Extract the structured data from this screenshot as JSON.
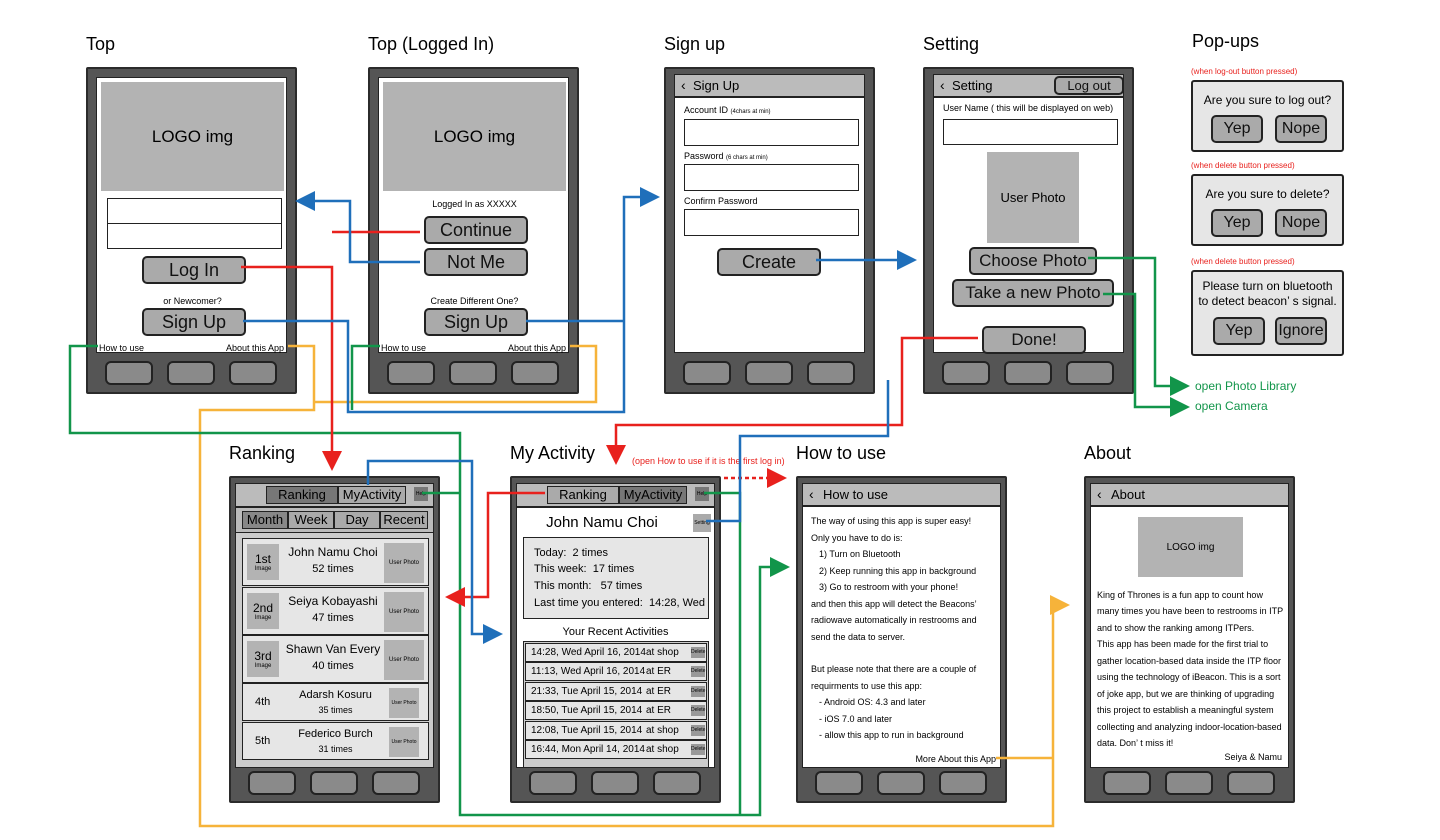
{
  "titles": {
    "top": "Top",
    "top_logged": "Top (Logged In)",
    "signup": "Sign up",
    "setting": "Setting",
    "popups": "Pop-ups",
    "ranking": "Ranking",
    "activity": "My Activity",
    "howto": "How to use",
    "about": "About"
  },
  "top": {
    "logo": "LOGO img",
    "login": "Log In",
    "newcomer": "or Newcomer?",
    "signup": "Sign Up",
    "howto": "How to use",
    "about": "About this App"
  },
  "top_logged": {
    "logo": "LOGO img",
    "logged_as": "Logged In as XXXXX",
    "continue": "Continue",
    "notme": "Not Me",
    "create_diff": "Create Different One?",
    "signup": "Sign Up",
    "howto": "How to use",
    "about": "About this App"
  },
  "signup": {
    "nav": "Sign Up",
    "account_label": "Account ID",
    "account_hint": "(4chars at min)",
    "password_label": "Password",
    "password_hint": "(6 chars at min)",
    "confirm_label": "Confirm Password",
    "create": "Create"
  },
  "setting": {
    "nav": "Setting",
    "logout": "Log out",
    "username_label": "User Name ( this will be displayed on web)",
    "photo": "User Photo",
    "choose": "Choose Photo",
    "take": "Take a new Photo",
    "done": "Done!"
  },
  "popups": [
    {
      "note": "(when log-out button pressed)",
      "text": "Are you sure to log out?",
      "btn1": "Yep",
      "btn2": "Nope"
    },
    {
      "note": "(when delete button pressed)",
      "text": "Are you sure to delete?",
      "btn1": "Yep",
      "btn2": "Nope"
    },
    {
      "note": "(when delete button pressed)",
      "text1": "Please turn on bluetooth",
      "text2": "to detect beacon’ s signal.",
      "btn1": "Yep",
      "btn2": "Ignore"
    }
  ],
  "side_notes": {
    "library": "open Photo Library",
    "camera": "open Camera",
    "first_login": "(open How to use if it is the first log in)"
  },
  "ranking": {
    "tab1": "Ranking",
    "tab2": "MyActivity",
    "help": "Help",
    "filters": [
      "Month",
      "Week",
      "Day",
      "Recent"
    ],
    "rows": [
      {
        "rank": "1st",
        "img": "Image",
        "name": "John Namu Choi",
        "count": "52 times",
        "photo": "User Photo"
      },
      {
        "rank": "2nd",
        "img": "Image",
        "name": "Seiya Kobayashi",
        "count": "47 times",
        "photo": "User Photo"
      },
      {
        "rank": "3rd",
        "img": "Image",
        "name": "Shawn Van Every",
        "count": "40 times",
        "photo": "User Photo"
      },
      {
        "rank": "4th",
        "img": "",
        "name": "Adarsh Kosuru",
        "count": "35 times",
        "photo": "User Photo"
      },
      {
        "rank": "5th",
        "img": "",
        "name": "Federico Burch",
        "count": "31 times",
        "photo": "User Photo"
      }
    ]
  },
  "activity": {
    "tab1": "Ranking",
    "tab2": "MyActivity",
    "help": "Help",
    "name": "John Namu Choi",
    "setting": "Setting",
    "stats": [
      {
        "label": "Today:",
        "value": "2 times"
      },
      {
        "label": "This week:",
        "value": "17 times"
      },
      {
        "label": "This month:",
        "value": "57 times"
      },
      {
        "label": "Last time you entered:",
        "value": "14:28, Wed"
      }
    ],
    "recent_title": "Your Recent Activities",
    "rows": [
      {
        "time": "14:28, Wed April 16, 2014",
        "place": "at shop",
        "del": "Delete"
      },
      {
        "time": "11:13, Wed April 16, 2014",
        "place": "at ER",
        "del": "Delete"
      },
      {
        "time": "21:33, Tue April 15, 2014",
        "place": "at ER",
        "del": "Delete"
      },
      {
        "time": "18:50, Tue April 15, 2014",
        "place": "at ER",
        "del": "Delete"
      },
      {
        "time": "12:08, Tue April 15, 2014",
        "place": "at shop",
        "del": "Delete"
      },
      {
        "time": "16:44, Mon April 14, 2014",
        "place": "at shop",
        "del": "Delete"
      }
    ]
  },
  "howto": {
    "nav": "How to use",
    "lines": [
      "The way of using this app is super easy!",
      "Only you have to do is:",
      "1) Turn on Bluetooth",
      "2) Keep running this app in background",
      "3) Go to restroom with your phone!",
      "and then this app will detect the Beacons’",
      "radiowave automatically in restrooms and",
      "send the data to server.",
      "",
      "But please note that there are a couple of",
      "requirments to use this app:",
      "- Android OS: 4.3 and later",
      "- iOS 7.0 and later",
      "- allow this app to run in background"
    ],
    "more": "More About this App"
  },
  "about": {
    "nav": "About",
    "logo": "LOGO img",
    "lines": [
      "King of Thrones is a fun app to count how",
      "many times you have been to restrooms in ITP",
      "and to show the ranking among ITPers.",
      "This app has been made for the first trial to",
      "gather location-based data inside the ITP floor",
      "using the technology of iBeacon. This is a sort",
      "of joke app, but we are thinking of upgrading",
      "this project to establish a meaningful system",
      "collecting and analyzing indoor-location-based",
      "data. Don’ t miss it!"
    ],
    "signature": "Seiya & Namu"
  },
  "colors": {
    "red": "#e8211d",
    "blue": "#1f6fba",
    "green": "#12954a",
    "yellow": "#f6b33a"
  }
}
